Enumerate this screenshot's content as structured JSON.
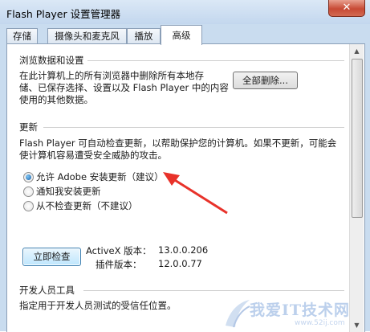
{
  "window": {
    "title": "Flash Player 设置管理器",
    "close_glyph": "✕"
  },
  "tabs": [
    {
      "label": "存储",
      "active": false
    },
    {
      "label": "摄像头和麦克风",
      "active": false
    },
    {
      "label": "播放",
      "active": false
    },
    {
      "label": "高级",
      "active": true
    }
  ],
  "browsing": {
    "heading": "浏览数据和设置",
    "desc_lines": [
      "在此计算机上的所有浏览器中删除所有本地存",
      "储、已保存选择、设置以及 Flash Player 中的内容",
      "使用的其他数据。"
    ],
    "delete_all_button": "全部删除..."
  },
  "updates": {
    "heading": "更新",
    "desc_lines": [
      "Flash Player 可自动检查更新，以帮助保护您的计算机。如果不更新，可能会",
      "使计算机容易遭受安全威胁的攻击。"
    ],
    "options": [
      {
        "label": "允许 Adobe 安装更新（建议）",
        "selected": true
      },
      {
        "label": "通知我安装更新",
        "selected": false
      },
      {
        "label": "从不检查更新（不建议）",
        "selected": false
      }
    ],
    "check_now_button": "立即检查",
    "activex_label": "ActiveX 版本：",
    "activex_version": "13.0.0.206",
    "plugin_label": "插件版本：",
    "plugin_version": "12.0.0.77"
  },
  "developer": {
    "heading": "开发人员工具",
    "desc": "指定用于开发人员测试的受信任位置。"
  },
  "watermark": {
    "text": "我爱IT技术网",
    "url": "www.52ij.com"
  },
  "colors": {
    "arrow": "#e8322a",
    "focus_button": "#3c7fb1"
  },
  "icons": [
    "close-icon",
    "scroll-up-icon",
    "scroll-down-icon",
    "annotation-arrow-icon"
  ]
}
